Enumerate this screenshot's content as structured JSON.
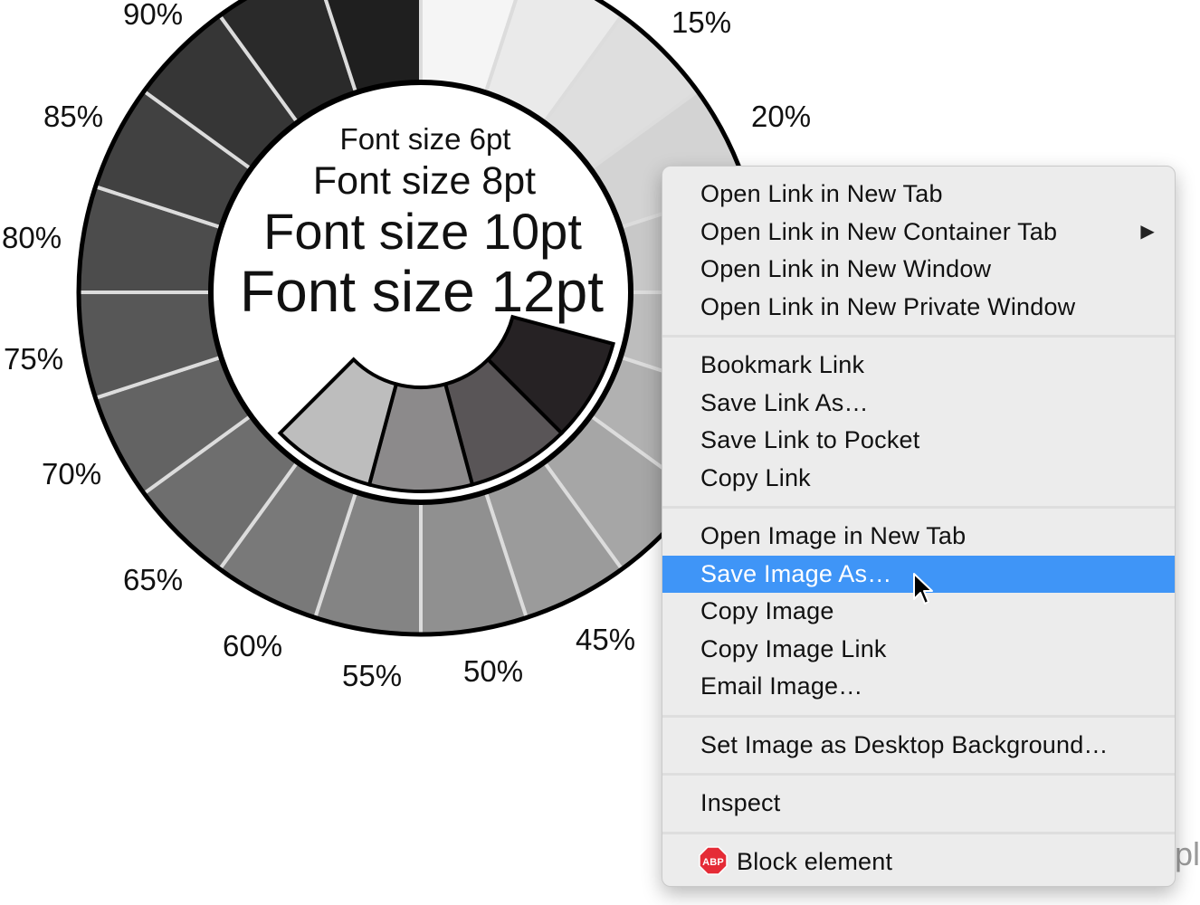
{
  "chart": {
    "percent_labels": [
      "15%",
      "20%",
      "45%",
      "50%",
      "55%",
      "60%",
      "65%",
      "70%",
      "75%",
      "80%",
      "85%",
      "90%"
    ],
    "font_samples": [
      "Font size 6pt",
      "Font size 8pt",
      "Font size 10pt",
      "Font size 12pt"
    ],
    "colors": {
      "ring_dark": "#1f1f1f",
      "ring_light": "#f4f4f4",
      "separator": "#dcdcdc"
    }
  },
  "background_fragment": "pl",
  "context_menu": {
    "groups": [
      [
        {
          "label": "Open Link in New Tab"
        },
        {
          "label": "Open Link in New Container Tab",
          "submenu": true
        },
        {
          "label": "Open Link in New Window"
        },
        {
          "label": "Open Link in New Private Window"
        }
      ],
      [
        {
          "label": "Bookmark Link"
        },
        {
          "label": "Save Link As…"
        },
        {
          "label": "Save Link to Pocket"
        },
        {
          "label": "Copy Link"
        }
      ],
      [
        {
          "label": "Open Image in New Tab"
        },
        {
          "label": "Save Image As…",
          "highlighted": true
        },
        {
          "label": "Copy Image"
        },
        {
          "label": "Copy Image Link"
        },
        {
          "label": "Email Image…"
        }
      ],
      [
        {
          "label": "Set Image as Desktop Background…"
        }
      ],
      [
        {
          "label": "Inspect"
        }
      ],
      [
        {
          "label": "Block element",
          "icon": "abp-icon",
          "icon_text": "ABP"
        }
      ]
    ],
    "highlight_color": "#3f95f7",
    "submenu_arrow": "▶"
  }
}
